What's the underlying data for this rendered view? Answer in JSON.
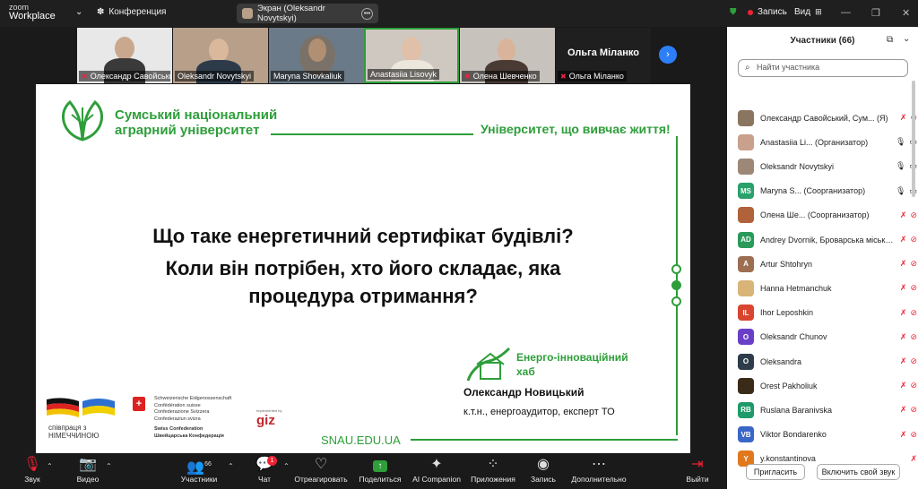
{
  "app": {
    "zoom": "zoom",
    "workplace": "Workplace",
    "meeting": "Конференция",
    "screen_pill": "Экран (Oleksandr Novytskyi)",
    "record": "Запись",
    "view": "Вид"
  },
  "thumbs": [
    {
      "name": "Олександр Савойськи...",
      "bg": "#e8e8e8"
    },
    {
      "name": "Oleksandr Novytskyi",
      "bg": "#b79f8a"
    },
    {
      "name": "Maryna Shovkaliuk",
      "bg": "#6b7a88"
    },
    {
      "name": "Anastasiia Lisovyk",
      "bg": "#cfc8c0"
    },
    {
      "name": "Олена Шевченко",
      "bg": "#c8c2bd"
    },
    {
      "name": "Ольга Міланко",
      "bg": "#1f1f1f",
      "big": "Ольга Міланко"
    }
  ],
  "slide": {
    "uni1": "Сумський національний",
    "uni2": "аграрний університет",
    "slogan": "Університет, що вивчає життя!",
    "q1": "Що таке енергетичний сертифікат будівлі?",
    "q2": "Коли він потрібен, хто його складає, яка",
    "q3": "процедура отримання?",
    "hub1": "Енерго-інноваційний",
    "hub2": "хаб",
    "speaker": "Олександр Новицький",
    "speaker_title": "к.т.н., енергоаудитор, експерт ТО",
    "site": "SNAU.EDU.UA",
    "de1": "співпраця з",
    "de2": "НІМЕЧЧИНОЮ",
    "ch1": "Schweizerische Eidgenossenschaft",
    "ch2": "Confédération suisse",
    "ch3": "Confederazione Svizzera",
    "ch4": "Confederaziun svizra",
    "ch5": "Swiss Confederation",
    "ch6": "Швейцарська Конфедерація",
    "giz_small": "Implemented by",
    "giz": "giz"
  },
  "panel": {
    "title": "Участники (66)",
    "search_placeholder": "Найти участника",
    "invite": "Пригласить",
    "unmute": "Включить свой звук",
    "participants": [
      {
        "name": "Олександр Савойський, Сум... (Я)",
        "av": "",
        "color": "#8a7560"
      },
      {
        "name": "Anastasiia Li... (Организатор)",
        "av": "",
        "color": "#c9a08c"
      },
      {
        "name": "Oleksandr Novytskyi",
        "av": "",
        "color": "#9d8878"
      },
      {
        "name": "Maryna S... (Соорганизатор)",
        "av": "MS",
        "color": "#2aa06a"
      },
      {
        "name": "Олена Ше... (Соорганизатор)",
        "av": "",
        "color": "#b0623a"
      },
      {
        "name": "Andrey Dvornik, Броварська міська ...",
        "av": "AD",
        "color": "#2a9a5a"
      },
      {
        "name": "Artur Shtohryn",
        "av": "A",
        "color": "#9c6e52"
      },
      {
        "name": "Hanna Hetmanchuk",
        "av": "",
        "color": "#d9b478"
      },
      {
        "name": "Ihor Leposhkin",
        "av": "IL",
        "color": "#d9452f"
      },
      {
        "name": "Oleksandr Chunov",
        "av": "O",
        "color": "#6a3fc8"
      },
      {
        "name": "Oleksandra",
        "av": "O",
        "color": "#2d3b4a"
      },
      {
        "name": "Orest Pakholiuk",
        "av": "",
        "color": "#3a2a18"
      },
      {
        "name": "Ruslana Baranivska",
        "av": "RB",
        "color": "#1f9a6a"
      },
      {
        "name": "Viktor Bondarenko",
        "av": "VB",
        "color": "#3a66c8"
      },
      {
        "name": "y.konstantinova",
        "av": "Y",
        "color": "#e2781e"
      }
    ]
  },
  "toolbar": {
    "sound": "Звук",
    "video": "Видео",
    "participants": "Участники",
    "participants_count": "66",
    "chat": "Чат",
    "chat_badge": "1",
    "react": "Отреагировать",
    "share": "Поделиться",
    "ai": "AI Companion",
    "apps": "Приложения",
    "rec": "Запись",
    "more": "Дополнительно",
    "leave": "Выйти"
  },
  "colors": {
    "green": "#2e9e3a",
    "leave_red": "#e0312b"
  }
}
